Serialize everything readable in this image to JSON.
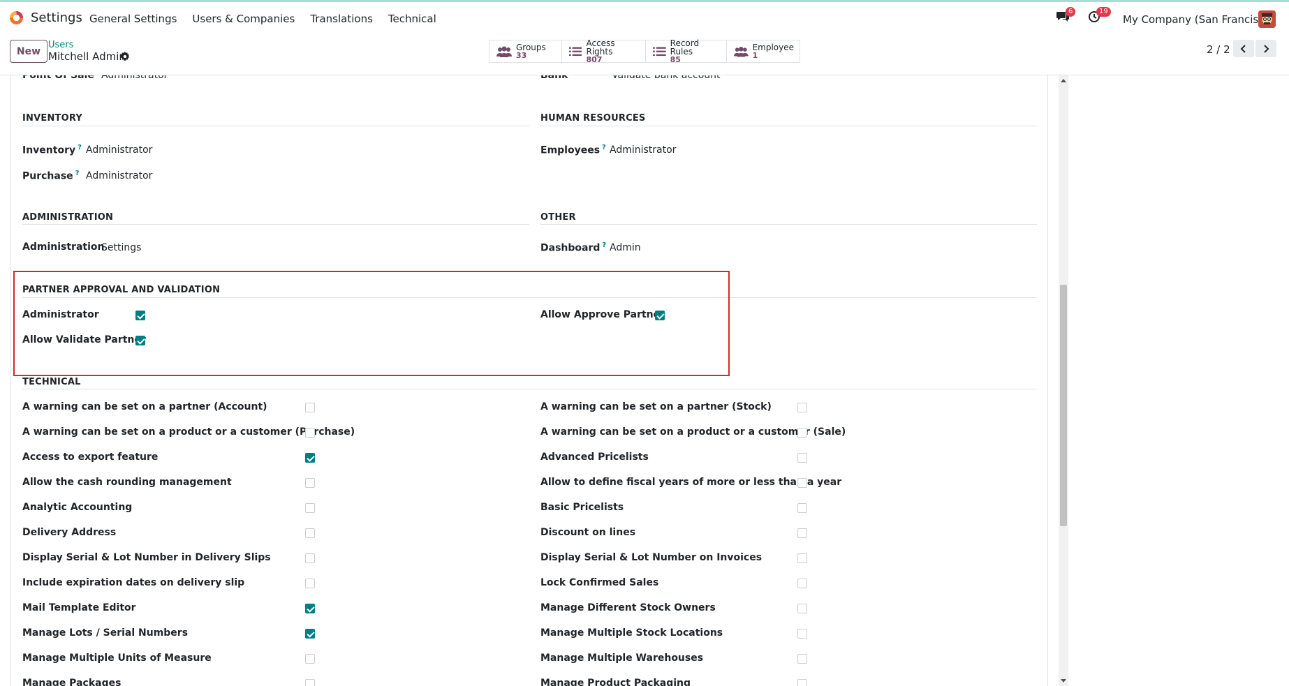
{
  "navbar": {
    "app_title": "Settings",
    "menu": [
      "General Settings",
      "Users & Companies",
      "Translations",
      "Technical"
    ],
    "messages_count": "6",
    "activities_count": "19",
    "company": "My Company (San Francisco)"
  },
  "control_panel": {
    "new_label": "New",
    "breadcrumb_parent": "Users",
    "breadcrumb_current": "Mitchell Admin",
    "smart_buttons": [
      {
        "label": "Groups",
        "value": "33"
      },
      {
        "label": "Access Rights",
        "value": "807"
      },
      {
        "label": "Record Rules",
        "value": "85"
      },
      {
        "label": "Employee",
        "value": "1"
      }
    ],
    "pager": "2 / 2"
  },
  "form": {
    "partial_top": {
      "left_label": "Point Of Sale",
      "left_value": "Administrator",
      "right_label": "Bank",
      "right_value": "Validate bank account"
    },
    "inventory": {
      "title": "INVENTORY",
      "rows": [
        {
          "label": "Inventory",
          "value": "Administrator"
        },
        {
          "label": "Purchase",
          "value": "Administrator"
        }
      ]
    },
    "human_resources": {
      "title": "HUMAN RESOURCES",
      "rows": [
        {
          "label": "Employees",
          "value": "Administrator"
        }
      ]
    },
    "administration": {
      "title": "ADMINISTRATION",
      "rows": [
        {
          "label": "Administration",
          "value": "Settings"
        }
      ]
    },
    "other": {
      "title": "OTHER",
      "rows": [
        {
          "label": "Dashboard",
          "value": "Admin"
        }
      ]
    },
    "partner_approval": {
      "title": "PARTNER APPROVAL AND VALIDATION",
      "left": [
        {
          "label": "Administrator",
          "checked": true
        },
        {
          "label": "Allow Validate Partner",
          "checked": true
        }
      ],
      "right": [
        {
          "label": "Allow Approve Partner",
          "checked": true
        }
      ]
    },
    "technical": {
      "title": "TECHNICAL",
      "left": [
        {
          "label": "A warning can be set on a partner (Account)",
          "checked": false
        },
        {
          "label": "A warning can be set on a product or a customer (Purchase)",
          "checked": false
        },
        {
          "label": "Access to export feature",
          "checked": true
        },
        {
          "label": "Allow the cash rounding management",
          "checked": false
        },
        {
          "label": "Analytic Accounting",
          "checked": false
        },
        {
          "label": "Delivery Address",
          "checked": false
        },
        {
          "label": "Display Serial & Lot Number in Delivery Slips",
          "checked": false
        },
        {
          "label": "Include expiration dates on delivery slip",
          "checked": false
        },
        {
          "label": "Mail Template Editor",
          "checked": true
        },
        {
          "label": "Manage Lots / Serial Numbers",
          "checked": true
        },
        {
          "label": "Manage Multiple Units of Measure",
          "checked": false
        },
        {
          "label": "Manage Packages",
          "checked": false
        }
      ],
      "right": [
        {
          "label": "A warning can be set on a partner (Stock)",
          "checked": false
        },
        {
          "label": "A warning can be set on a product or a customer (Sale)",
          "checked": false
        },
        {
          "label": "Advanced Pricelists",
          "checked": false
        },
        {
          "label": "Allow to define fiscal years of more or less than a year",
          "checked": false
        },
        {
          "label": "Basic Pricelists",
          "checked": false
        },
        {
          "label": "Discount on lines",
          "checked": false
        },
        {
          "label": "Display Serial & Lot Number on Invoices",
          "checked": false
        },
        {
          "label": "Lock Confirmed Sales",
          "checked": false
        },
        {
          "label": "Manage Different Stock Owners",
          "checked": false
        },
        {
          "label": "Manage Multiple Stock Locations",
          "checked": false
        },
        {
          "label": "Manage Multiple Warehouses",
          "checked": false
        },
        {
          "label": "Manage Product Packaging",
          "checked": false
        }
      ]
    }
  },
  "colors": {
    "primary": "#714b67",
    "accent": "#017e84",
    "highlight": "#d9262c"
  }
}
